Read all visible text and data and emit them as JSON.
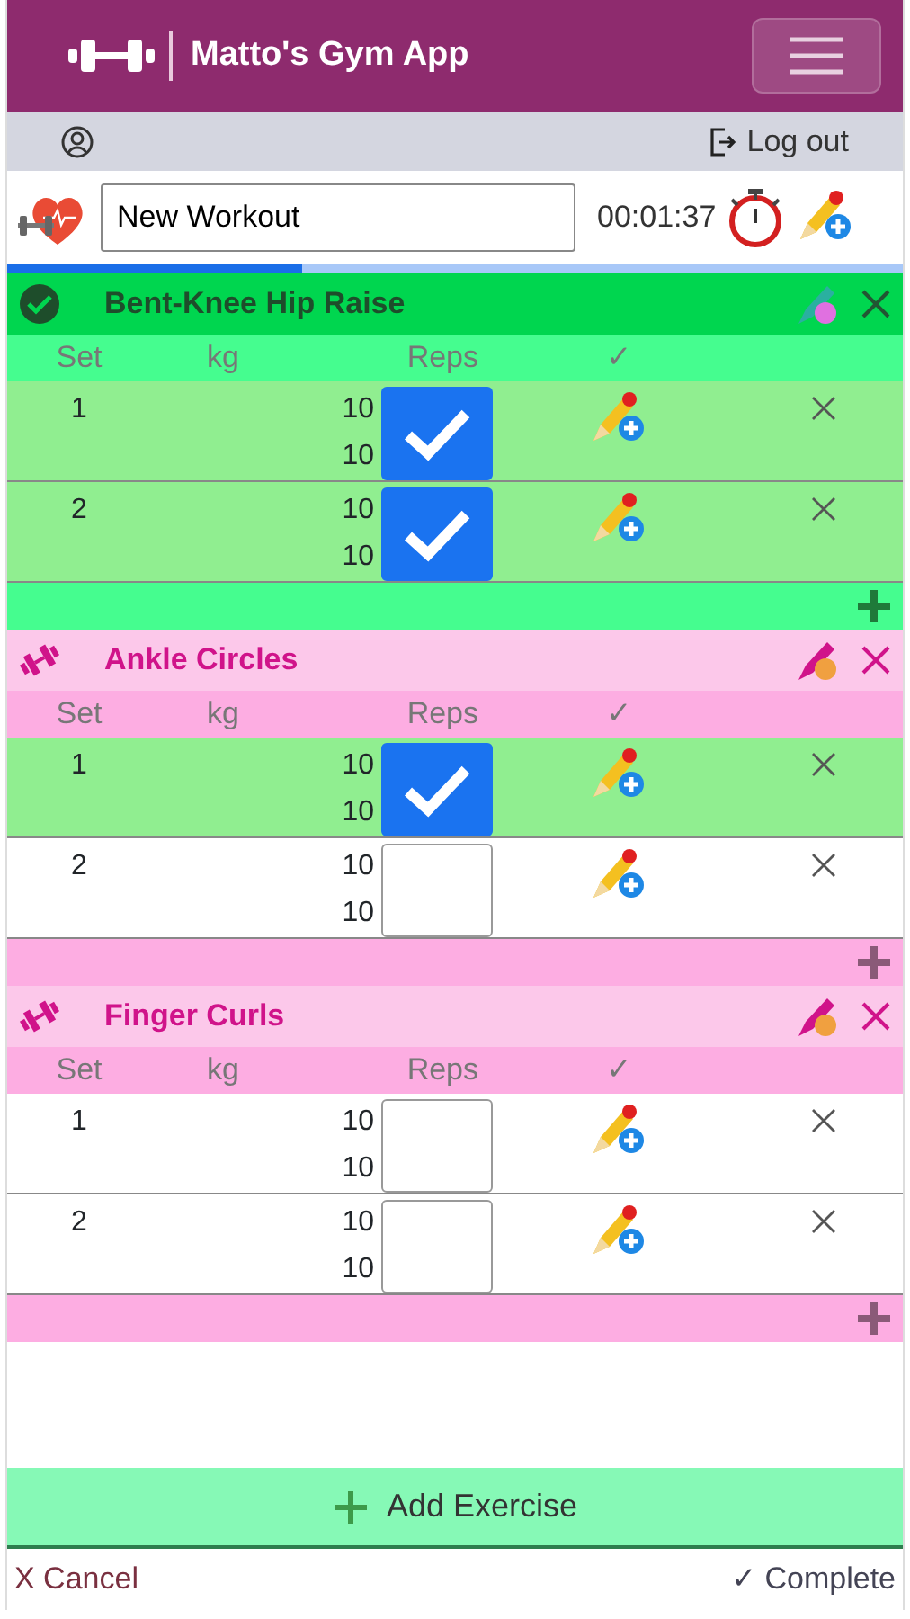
{
  "navbar": {
    "title": "Matto's Gym App"
  },
  "user_bar": {
    "logout": "Log out"
  },
  "workout": {
    "name": "New Workout",
    "timer": "00:01:37",
    "progress": {
      "level": 0.33
    }
  },
  "exercises": [
    {
      "name": "Bent-Knee Hip Raise",
      "kind": "done",
      "columns": [
        "Set",
        "kg",
        "Reps",
        "✓"
      ],
      "sets": [
        {
          "set": "1",
          "reps": [
            "10",
            "10"
          ],
          "done": true
        },
        {
          "set": "2",
          "reps": [
            "10",
            "10"
          ],
          "done": true
        }
      ]
    },
    {
      "name": "Ankle Circles",
      "kind": "active",
      "columns": [
        "Set",
        "kg",
        "Reps",
        "✓"
      ],
      "sets": [
        {
          "set": "1",
          "reps": [
            "10",
            "10"
          ],
          "done": true
        },
        {
          "set": "2",
          "reps": [
            "10",
            "10"
          ],
          "done": false
        }
      ]
    },
    {
      "name": "Finger Curls",
      "kind": "active",
      "columns": [
        "Set",
        "kg",
        "Reps",
        "✓"
      ],
      "sets": [
        {
          "set": "1",
          "reps": [
            "10",
            "10"
          ],
          "done": false
        },
        {
          "set": "2",
          "reps": [
            "10",
            "10"
          ],
          "done": false
        }
      ]
    }
  ],
  "add_exercise": "Add Exercise",
  "footer": {
    "cancel": "X Cancel",
    "complete": "✓ Complete"
  }
}
